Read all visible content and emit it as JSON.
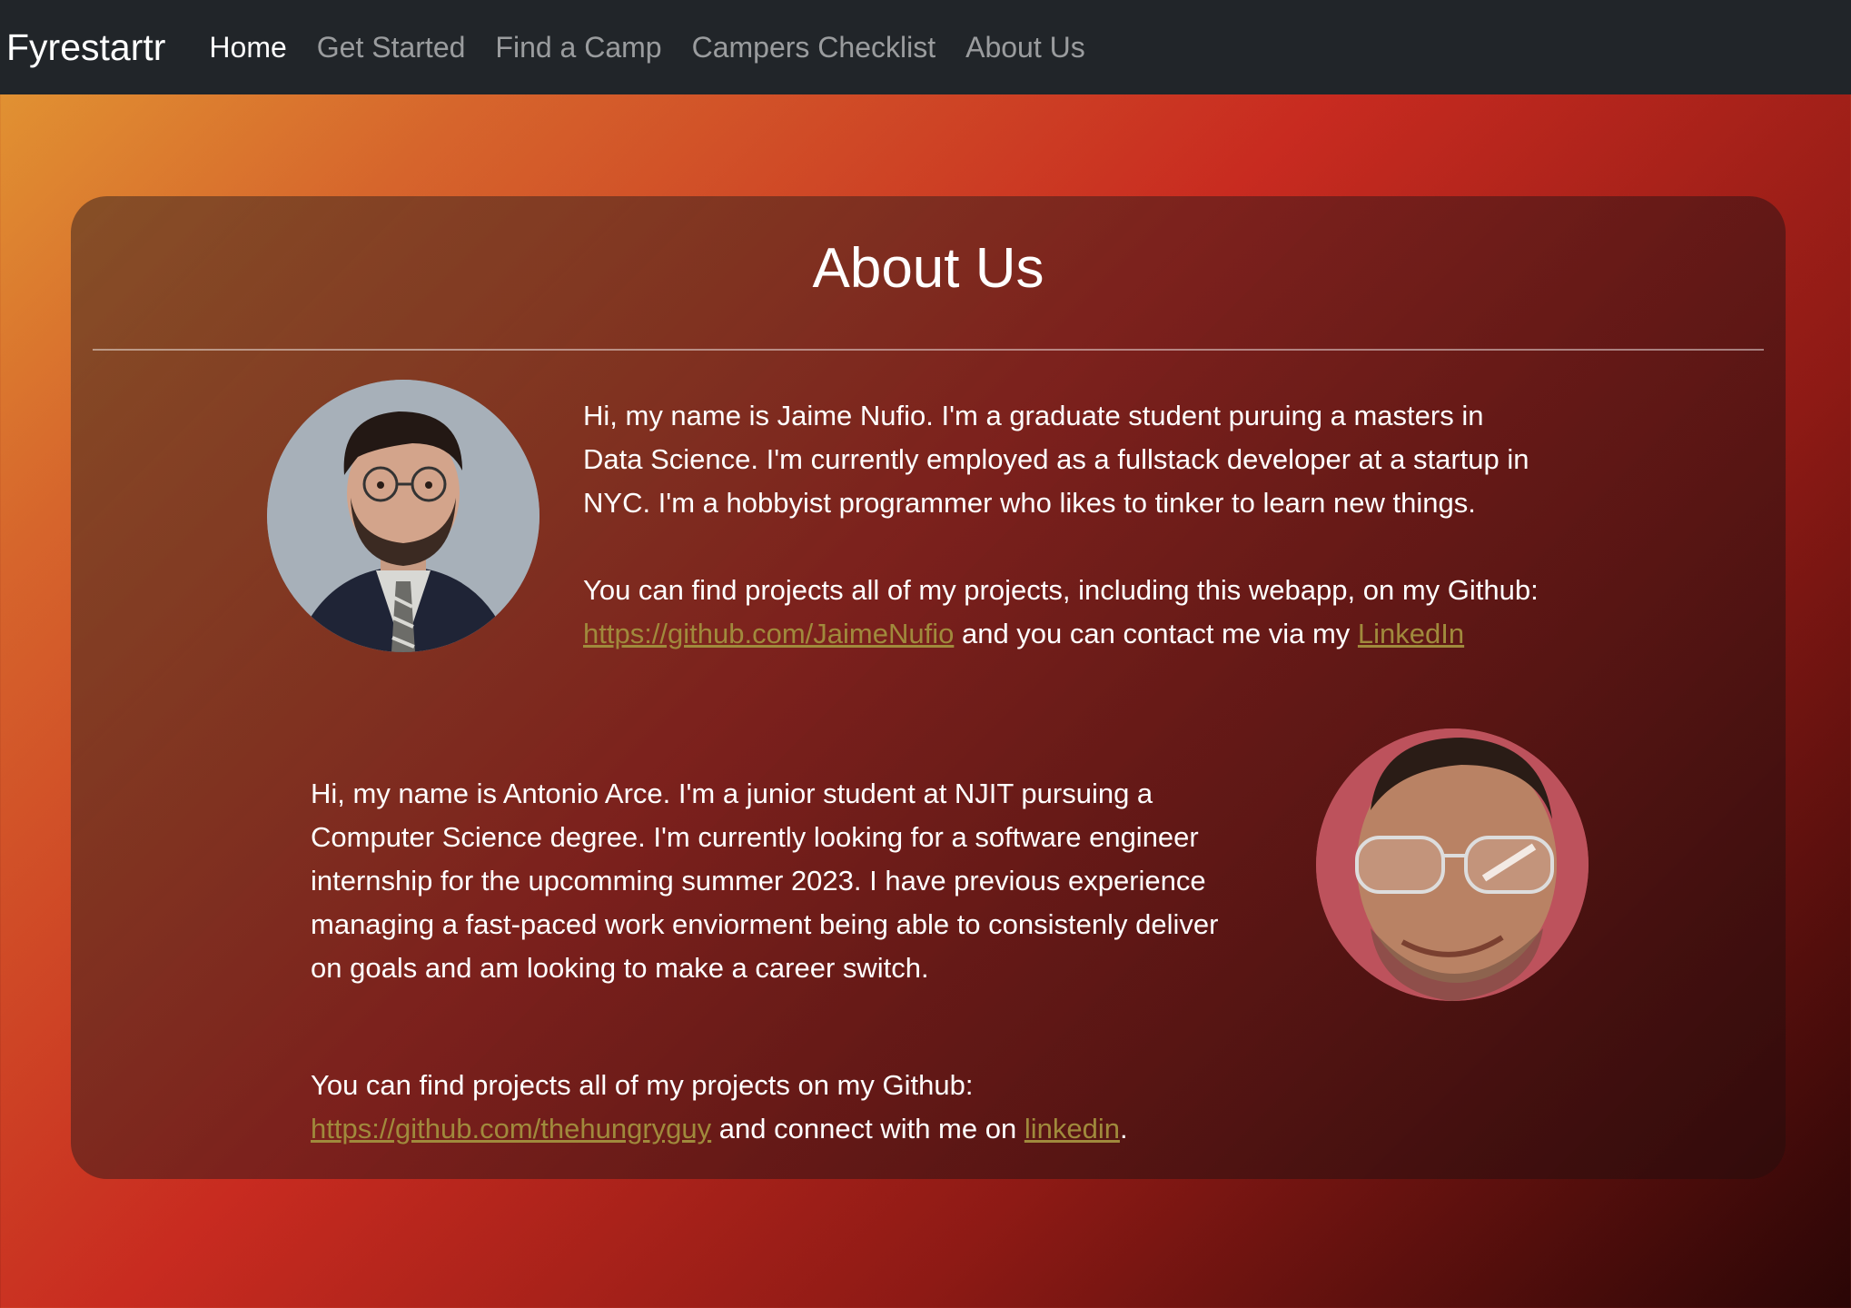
{
  "nav": {
    "brand": "Fyrestartr",
    "links": [
      "Home",
      "Get Started",
      "Find a Camp",
      "Campers Checklist",
      "About Us"
    ]
  },
  "page": {
    "title": "About Us"
  },
  "members": [
    {
      "name_image": "jaime-photo",
      "bio": "Hi, my name is Jaime Nufio. I'm a graduate student puruing a masters in Data Science. I'm currently employed as a fullstack developer at a startup in NYC. I'm a hobbyist programmer who likes to tinker to learn new things.",
      "links_prefix": "You can find projects all of my projects, including this webapp, on my Github: ",
      "github_url": "https://github.com/JaimeNufio",
      "links_middle": " and you can contact me via my ",
      "linkedin_text": "LinkedIn",
      "links_suffix": ""
    },
    {
      "name_image": "antonio-photo",
      "bio": "Hi, my name is Antonio Arce. I'm a junior student at NJIT pursuing a Computer Science degree. I'm currently looking for a software engineer internship for the upcomming summer 2023. I have previous experience managing a fast-paced work enviorment being able to consistenly deliver on goals and am looking to make a career switch.",
      "links_prefix": "You can find projects all of my projects on my Github: ",
      "github_url": "https://github.com/thehungryguy",
      "links_middle": " and connect with me on ",
      "linkedin_text": "linkedin",
      "links_suffix": "."
    }
  ],
  "colors": {
    "navbar": "#212529",
    "link": "#a08a3c"
  }
}
